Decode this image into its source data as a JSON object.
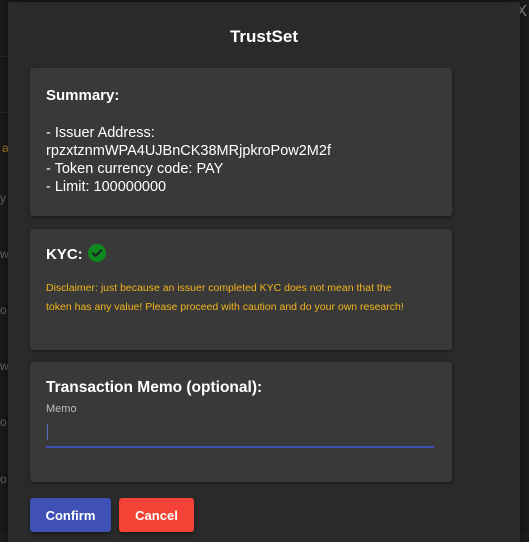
{
  "background": {
    "partial_letters": [
      "a",
      "y",
      "w",
      "o",
      "w",
      "o",
      "o"
    ],
    "close_glyph": "X"
  },
  "dialog": {
    "title": "TrustSet"
  },
  "summary": {
    "heading": "Summary:",
    "issuer_line_label": "- Issuer Address:",
    "issuer_address": "rpzxtznmWPA4UJBnCK38MRjpkroPow2M2f",
    "currency_line": "- Token currency code: PAY",
    "limit_line": "- Limit: 100000000"
  },
  "kyc": {
    "heading": "KYC:",
    "status_icon": "check-circle-icon",
    "status_color": "#0f8a1f",
    "disclaimer": "Disclaimer: just because an issuer completed KYC does not mean that the token has any value! Please proceed with caution and do your own research!",
    "disclaimer_color": "#f2b41b"
  },
  "memo": {
    "heading": "Transaction Memo (optional):",
    "field_label": "Memo",
    "value": "",
    "accent_color": "#3f51b5"
  },
  "actions": {
    "confirm_label": "Confirm",
    "confirm_color": "#3f51b5",
    "cancel_label": "Cancel",
    "cancel_color": "#f44336"
  }
}
